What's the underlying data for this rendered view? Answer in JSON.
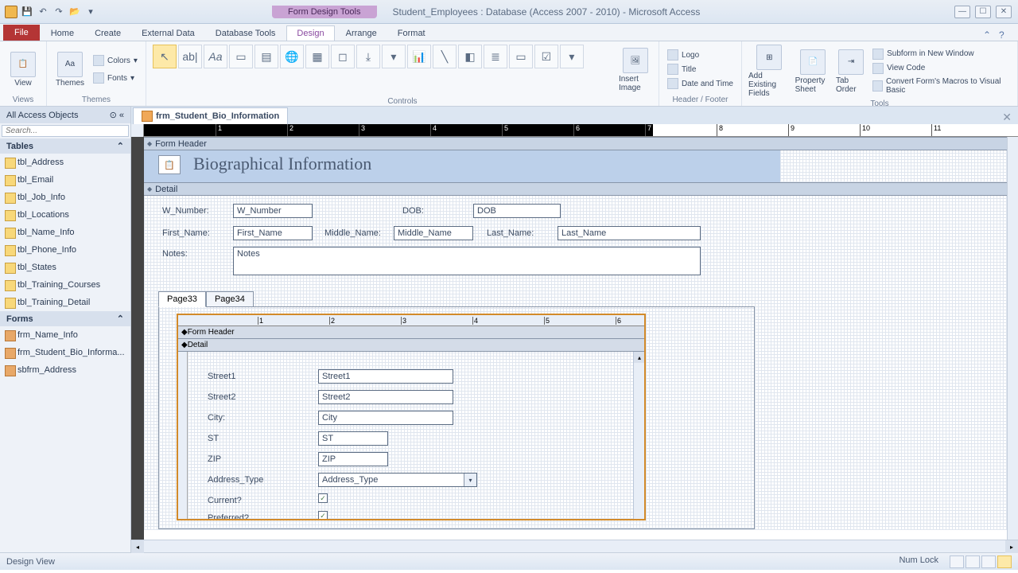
{
  "titlebar": {
    "contextual_tab": "Form Design Tools",
    "document_title": "Student_Employees : Database (Access 2007 - 2010) - Microsoft Access"
  },
  "ribbon": {
    "file": "File",
    "tabs": [
      "Home",
      "Create",
      "External Data",
      "Database Tools",
      "Design",
      "Arrange",
      "Format"
    ],
    "active_tab": "Design",
    "groups": {
      "views": {
        "label": "Views",
        "view_btn": "View"
      },
      "themes": {
        "label": "Themes",
        "themes_btn": "Themes",
        "colors": "Colors",
        "fonts": "Fonts"
      },
      "controls": {
        "label": "Controls"
      },
      "insert_image": {
        "btn": "Insert Image"
      },
      "header_footer": {
        "label": "Header / Footer",
        "logo": "Logo",
        "title": "Title",
        "date_time": "Date and Time"
      },
      "tools": {
        "label": "Tools",
        "add_fields": "Add Existing Fields",
        "property_sheet": "Property Sheet",
        "tab_order": "Tab Order",
        "subform": "Subform in New Window",
        "view_code": "View Code",
        "convert_macros": "Convert Form's Macros to Visual Basic"
      }
    }
  },
  "navpane": {
    "header": "All Access Objects",
    "search_placeholder": "Search...",
    "tables_hdr": "Tables",
    "tables": [
      "tbl_Address",
      "tbl_Email",
      "tbl_Job_Info",
      "tbl_Locations",
      "tbl_Name_Info",
      "tbl_Phone_Info",
      "tbl_States",
      "tbl_Training_Courses",
      "tbl_Training_Detail"
    ],
    "forms_hdr": "Forms",
    "forms": [
      "frm_Name_Info",
      "frm_Student_Bio_Informa...",
      "sbfrm_Address"
    ]
  },
  "documents": {
    "active_tab": "frm_Student_Bio_Information"
  },
  "ruler": {
    "marks": [
      "1",
      "2",
      "3",
      "4",
      "5",
      "6",
      "7",
      "8",
      "9",
      "10",
      "11"
    ]
  },
  "form": {
    "form_header_bar": "Form Header",
    "detail_bar": "Detail",
    "title": "Biographical Information",
    "fields": {
      "w_number": {
        "label": "W_Number:",
        "bound": "W_Number"
      },
      "dob": {
        "label": "DOB:",
        "bound": "DOB"
      },
      "first_name": {
        "label": "First_Name:",
        "bound": "First_Name"
      },
      "middle_name": {
        "label": "Middle_Name:",
        "bound": "Middle_Name"
      },
      "last_name": {
        "label": "Last_Name:",
        "bound": "Last_Name"
      },
      "notes": {
        "label": "Notes:",
        "bound": "Notes"
      }
    },
    "tabcontrol": {
      "pages": [
        "Page33",
        "Page34"
      ],
      "active": "Page33"
    },
    "subform": {
      "ruler": [
        "1",
        "2",
        "3",
        "4",
        "5",
        "6"
      ],
      "form_header_bar": "Form Header",
      "detail_bar": "Detail",
      "fields": {
        "street1": {
          "label": "Street1",
          "bound": "Street1"
        },
        "street2": {
          "label": "Street2",
          "bound": "Street2"
        },
        "city": {
          "label": "City:",
          "bound": "City"
        },
        "st": {
          "label": "ST",
          "bound": "ST"
        },
        "zip": {
          "label": "ZIP",
          "bound": "ZIP"
        },
        "address_type": {
          "label": "Address_Type",
          "bound": "Address_Type"
        },
        "current": {
          "label": "Current?"
        },
        "preferred": {
          "label": "Preferred?"
        }
      }
    }
  },
  "statusbar": {
    "left": "Design View",
    "numlock": "Num Lock"
  }
}
